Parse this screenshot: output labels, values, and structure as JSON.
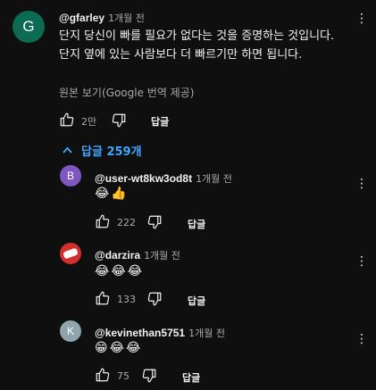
{
  "comment": {
    "avatar_letter": "G",
    "handle": "@gfarley",
    "time": "1개월 전",
    "text": "단지 당신이 빠를 필요가 없다는 것을 증명하는 것입니다. 단지 옆에 있는 사람보다 더 빠르기만 하면 됩니다.",
    "translate_link": "원본 보기(Google 번역 제공)",
    "likes": "2만",
    "reply_label": "답글",
    "replies_toggle": "답글 259개"
  },
  "replies": [
    {
      "avatar_letter": "B",
      "handle": "@user-wt8kw3od8t",
      "time": "1개월 전",
      "emoji": "😂👍",
      "likes": "222",
      "reply_label": "답글"
    },
    {
      "avatar_letter": "",
      "handle": "@darzira",
      "time": "1개월 전",
      "emoji": "😂😂😂",
      "likes": "133",
      "reply_label": "답글"
    },
    {
      "avatar_letter": "K",
      "handle": "@kevinethan5751",
      "time": "1개월 전",
      "emoji": "😁😂😂",
      "likes": "75",
      "reply_label": "답글"
    }
  ],
  "colors": {
    "background": "#0f0f0f",
    "link_blue": "#3ea6ff",
    "avatar_g": "#0b6b53",
    "avatar_b": "#7e57c2",
    "avatar_k": "#8fa4ab",
    "avatar_darzira": "#d32f2f"
  }
}
